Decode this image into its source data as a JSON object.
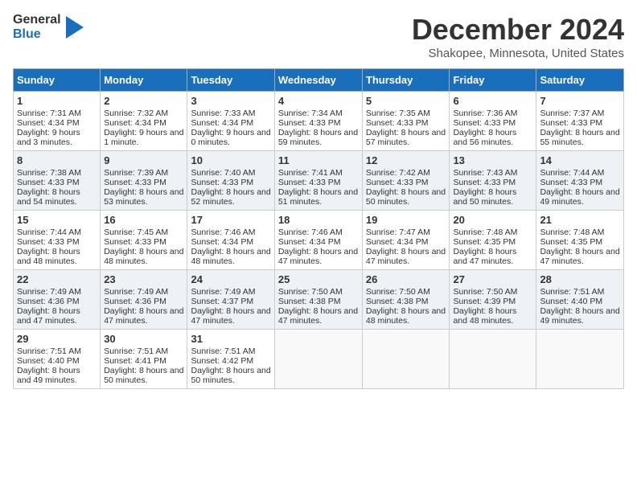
{
  "logo": {
    "general": "General",
    "blue": "Blue"
  },
  "header": {
    "month": "December 2024",
    "location": "Shakopee, Minnesota, United States"
  },
  "days": [
    "Sunday",
    "Monday",
    "Tuesday",
    "Wednesday",
    "Thursday",
    "Friday",
    "Saturday"
  ],
  "weeks": [
    [
      {
        "day": 1,
        "sr": "Sunrise: 7:31 AM",
        "ss": "Sunset: 4:34 PM",
        "dl": "Daylight: 9 hours and 3 minutes."
      },
      {
        "day": 2,
        "sr": "Sunrise: 7:32 AM",
        "ss": "Sunset: 4:34 PM",
        "dl": "Daylight: 9 hours and 1 minute."
      },
      {
        "day": 3,
        "sr": "Sunrise: 7:33 AM",
        "ss": "Sunset: 4:34 PM",
        "dl": "Daylight: 9 hours and 0 minutes."
      },
      {
        "day": 4,
        "sr": "Sunrise: 7:34 AM",
        "ss": "Sunset: 4:33 PM",
        "dl": "Daylight: 8 hours and 59 minutes."
      },
      {
        "day": 5,
        "sr": "Sunrise: 7:35 AM",
        "ss": "Sunset: 4:33 PM",
        "dl": "Daylight: 8 hours and 57 minutes."
      },
      {
        "day": 6,
        "sr": "Sunrise: 7:36 AM",
        "ss": "Sunset: 4:33 PM",
        "dl": "Daylight: 8 hours and 56 minutes."
      },
      {
        "day": 7,
        "sr": "Sunrise: 7:37 AM",
        "ss": "Sunset: 4:33 PM",
        "dl": "Daylight: 8 hours and 55 minutes."
      }
    ],
    [
      {
        "day": 8,
        "sr": "Sunrise: 7:38 AM",
        "ss": "Sunset: 4:33 PM",
        "dl": "Daylight: 8 hours and 54 minutes."
      },
      {
        "day": 9,
        "sr": "Sunrise: 7:39 AM",
        "ss": "Sunset: 4:33 PM",
        "dl": "Daylight: 8 hours and 53 minutes."
      },
      {
        "day": 10,
        "sr": "Sunrise: 7:40 AM",
        "ss": "Sunset: 4:33 PM",
        "dl": "Daylight: 8 hours and 52 minutes."
      },
      {
        "day": 11,
        "sr": "Sunrise: 7:41 AM",
        "ss": "Sunset: 4:33 PM",
        "dl": "Daylight: 8 hours and 51 minutes."
      },
      {
        "day": 12,
        "sr": "Sunrise: 7:42 AM",
        "ss": "Sunset: 4:33 PM",
        "dl": "Daylight: 8 hours and 50 minutes."
      },
      {
        "day": 13,
        "sr": "Sunrise: 7:43 AM",
        "ss": "Sunset: 4:33 PM",
        "dl": "Daylight: 8 hours and 50 minutes."
      },
      {
        "day": 14,
        "sr": "Sunrise: 7:44 AM",
        "ss": "Sunset: 4:33 PM",
        "dl": "Daylight: 8 hours and 49 minutes."
      }
    ],
    [
      {
        "day": 15,
        "sr": "Sunrise: 7:44 AM",
        "ss": "Sunset: 4:33 PM",
        "dl": "Daylight: 8 hours and 48 minutes."
      },
      {
        "day": 16,
        "sr": "Sunrise: 7:45 AM",
        "ss": "Sunset: 4:33 PM",
        "dl": "Daylight: 8 hours and 48 minutes."
      },
      {
        "day": 17,
        "sr": "Sunrise: 7:46 AM",
        "ss": "Sunset: 4:34 PM",
        "dl": "Daylight: 8 hours and 48 minutes."
      },
      {
        "day": 18,
        "sr": "Sunrise: 7:46 AM",
        "ss": "Sunset: 4:34 PM",
        "dl": "Daylight: 8 hours and 47 minutes."
      },
      {
        "day": 19,
        "sr": "Sunrise: 7:47 AM",
        "ss": "Sunset: 4:34 PM",
        "dl": "Daylight: 8 hours and 47 minutes."
      },
      {
        "day": 20,
        "sr": "Sunrise: 7:48 AM",
        "ss": "Sunset: 4:35 PM",
        "dl": "Daylight: 8 hours and 47 minutes."
      },
      {
        "day": 21,
        "sr": "Sunrise: 7:48 AM",
        "ss": "Sunset: 4:35 PM",
        "dl": "Daylight: 8 hours and 47 minutes."
      }
    ],
    [
      {
        "day": 22,
        "sr": "Sunrise: 7:49 AM",
        "ss": "Sunset: 4:36 PM",
        "dl": "Daylight: 8 hours and 47 minutes."
      },
      {
        "day": 23,
        "sr": "Sunrise: 7:49 AM",
        "ss": "Sunset: 4:36 PM",
        "dl": "Daylight: 8 hours and 47 minutes."
      },
      {
        "day": 24,
        "sr": "Sunrise: 7:49 AM",
        "ss": "Sunset: 4:37 PM",
        "dl": "Daylight: 8 hours and 47 minutes."
      },
      {
        "day": 25,
        "sr": "Sunrise: 7:50 AM",
        "ss": "Sunset: 4:38 PM",
        "dl": "Daylight: 8 hours and 47 minutes."
      },
      {
        "day": 26,
        "sr": "Sunrise: 7:50 AM",
        "ss": "Sunset: 4:38 PM",
        "dl": "Daylight: 8 hours and 48 minutes."
      },
      {
        "day": 27,
        "sr": "Sunrise: 7:50 AM",
        "ss": "Sunset: 4:39 PM",
        "dl": "Daylight: 8 hours and 48 minutes."
      },
      {
        "day": 28,
        "sr": "Sunrise: 7:51 AM",
        "ss": "Sunset: 4:40 PM",
        "dl": "Daylight: 8 hours and 49 minutes."
      }
    ],
    [
      {
        "day": 29,
        "sr": "Sunrise: 7:51 AM",
        "ss": "Sunset: 4:40 PM",
        "dl": "Daylight: 8 hours and 49 minutes."
      },
      {
        "day": 30,
        "sr": "Sunrise: 7:51 AM",
        "ss": "Sunset: 4:41 PM",
        "dl": "Daylight: 8 hours and 50 minutes."
      },
      {
        "day": 31,
        "sr": "Sunrise: 7:51 AM",
        "ss": "Sunset: 4:42 PM",
        "dl": "Daylight: 8 hours and 50 minutes."
      },
      null,
      null,
      null,
      null
    ]
  ]
}
